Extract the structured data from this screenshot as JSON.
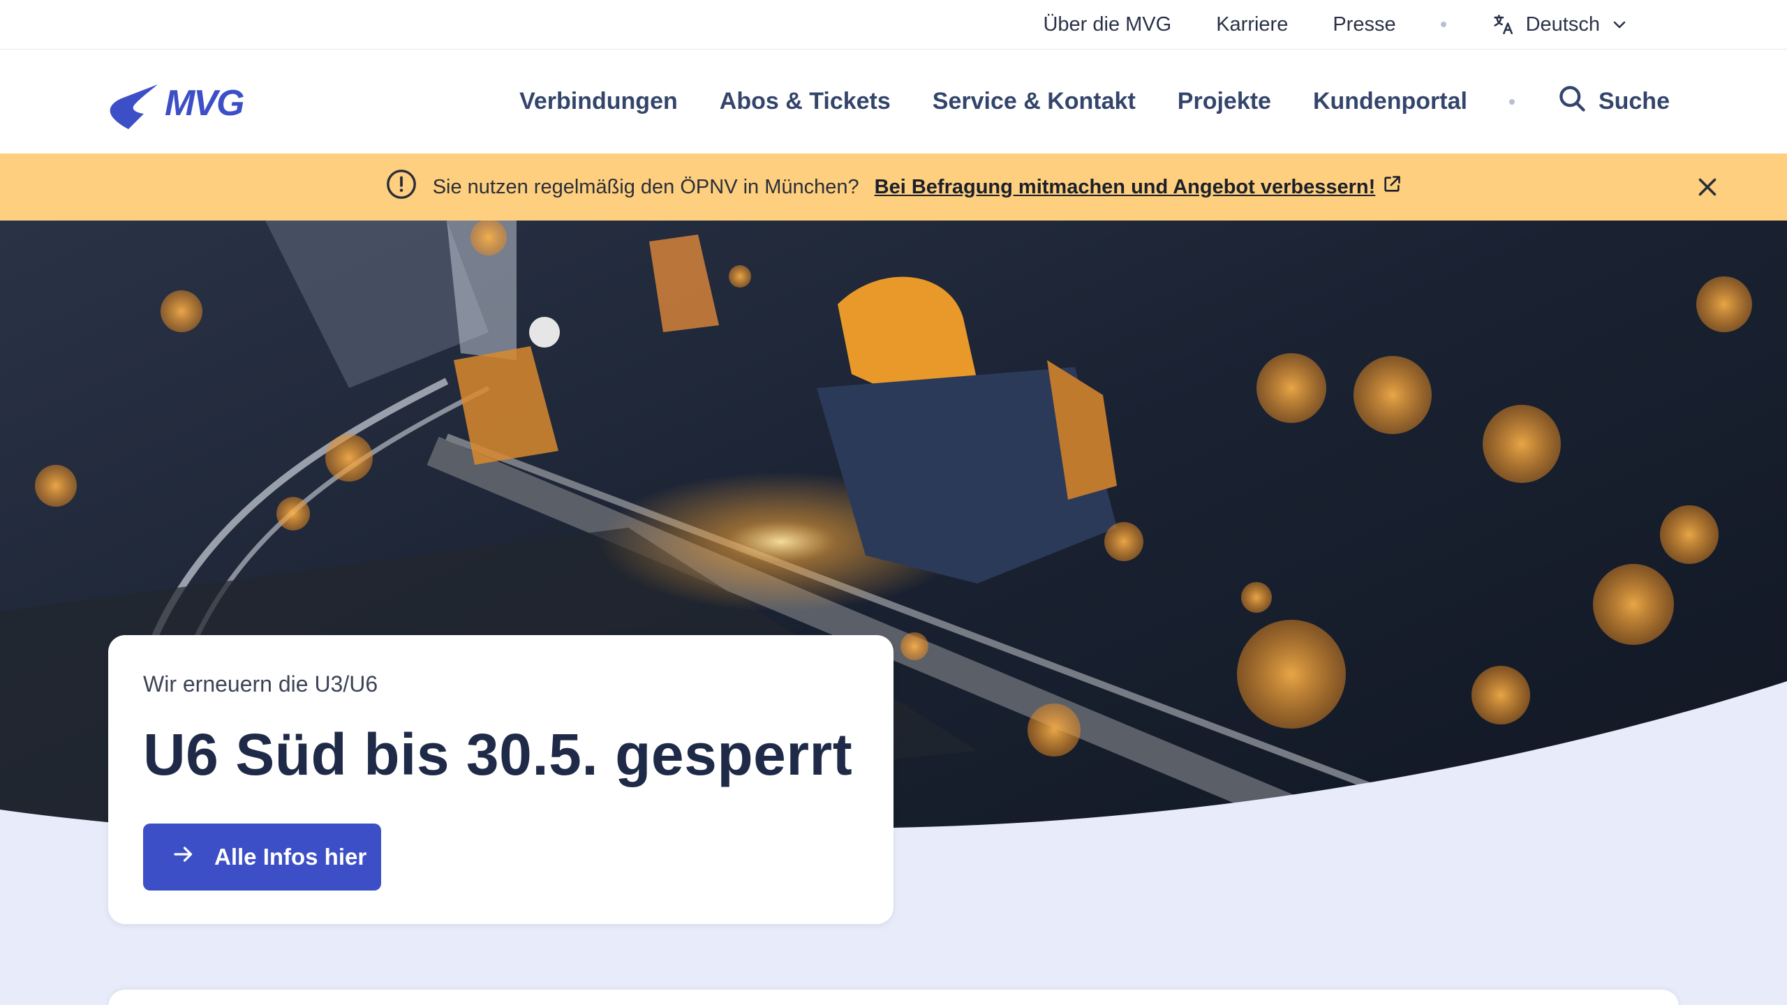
{
  "utility": {
    "links": [
      "Über die MVG",
      "Karriere",
      "Presse"
    ],
    "language": "Deutsch"
  },
  "brand": {
    "logo_text": "MVG",
    "color": "#3d4fc6"
  },
  "nav": {
    "items": [
      "Verbindungen",
      "Abos & Tickets",
      "Service & Kontakt",
      "Projekte",
      "Kundenportal"
    ],
    "search_label": "Suche"
  },
  "banner": {
    "text": "Sie nutzen regelmäßig den ÖPNV in München?",
    "link_text": "Bei Befragung mitmachen und Angebot verbessern!",
    "color": "#fdcf7e"
  },
  "hero": {
    "kicker": "Wir erneuern die U3/U6",
    "title": "U6 Süd bis 30.5. gesperrt",
    "cta_label": "Alle Infos hier"
  }
}
